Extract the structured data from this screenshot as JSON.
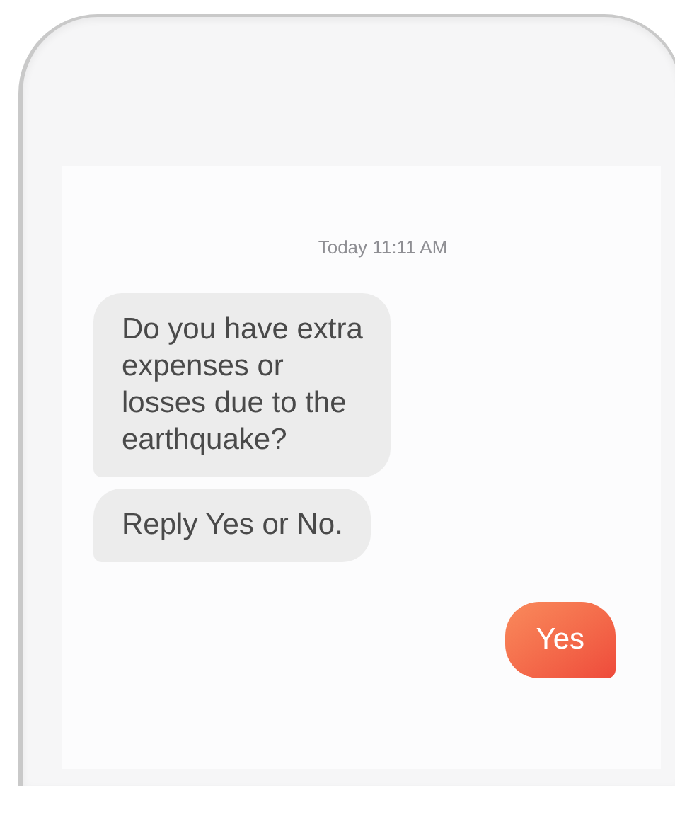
{
  "timestamp": "Today 11:11 AM",
  "messages": [
    {
      "kind": "incoming",
      "text": "Do you have extra\nexpenses or\nlosses due to the\nearthquake?"
    },
    {
      "kind": "incoming",
      "text": "Reply Yes or No."
    },
    {
      "kind": "outgoing",
      "text": "Yes"
    }
  ]
}
